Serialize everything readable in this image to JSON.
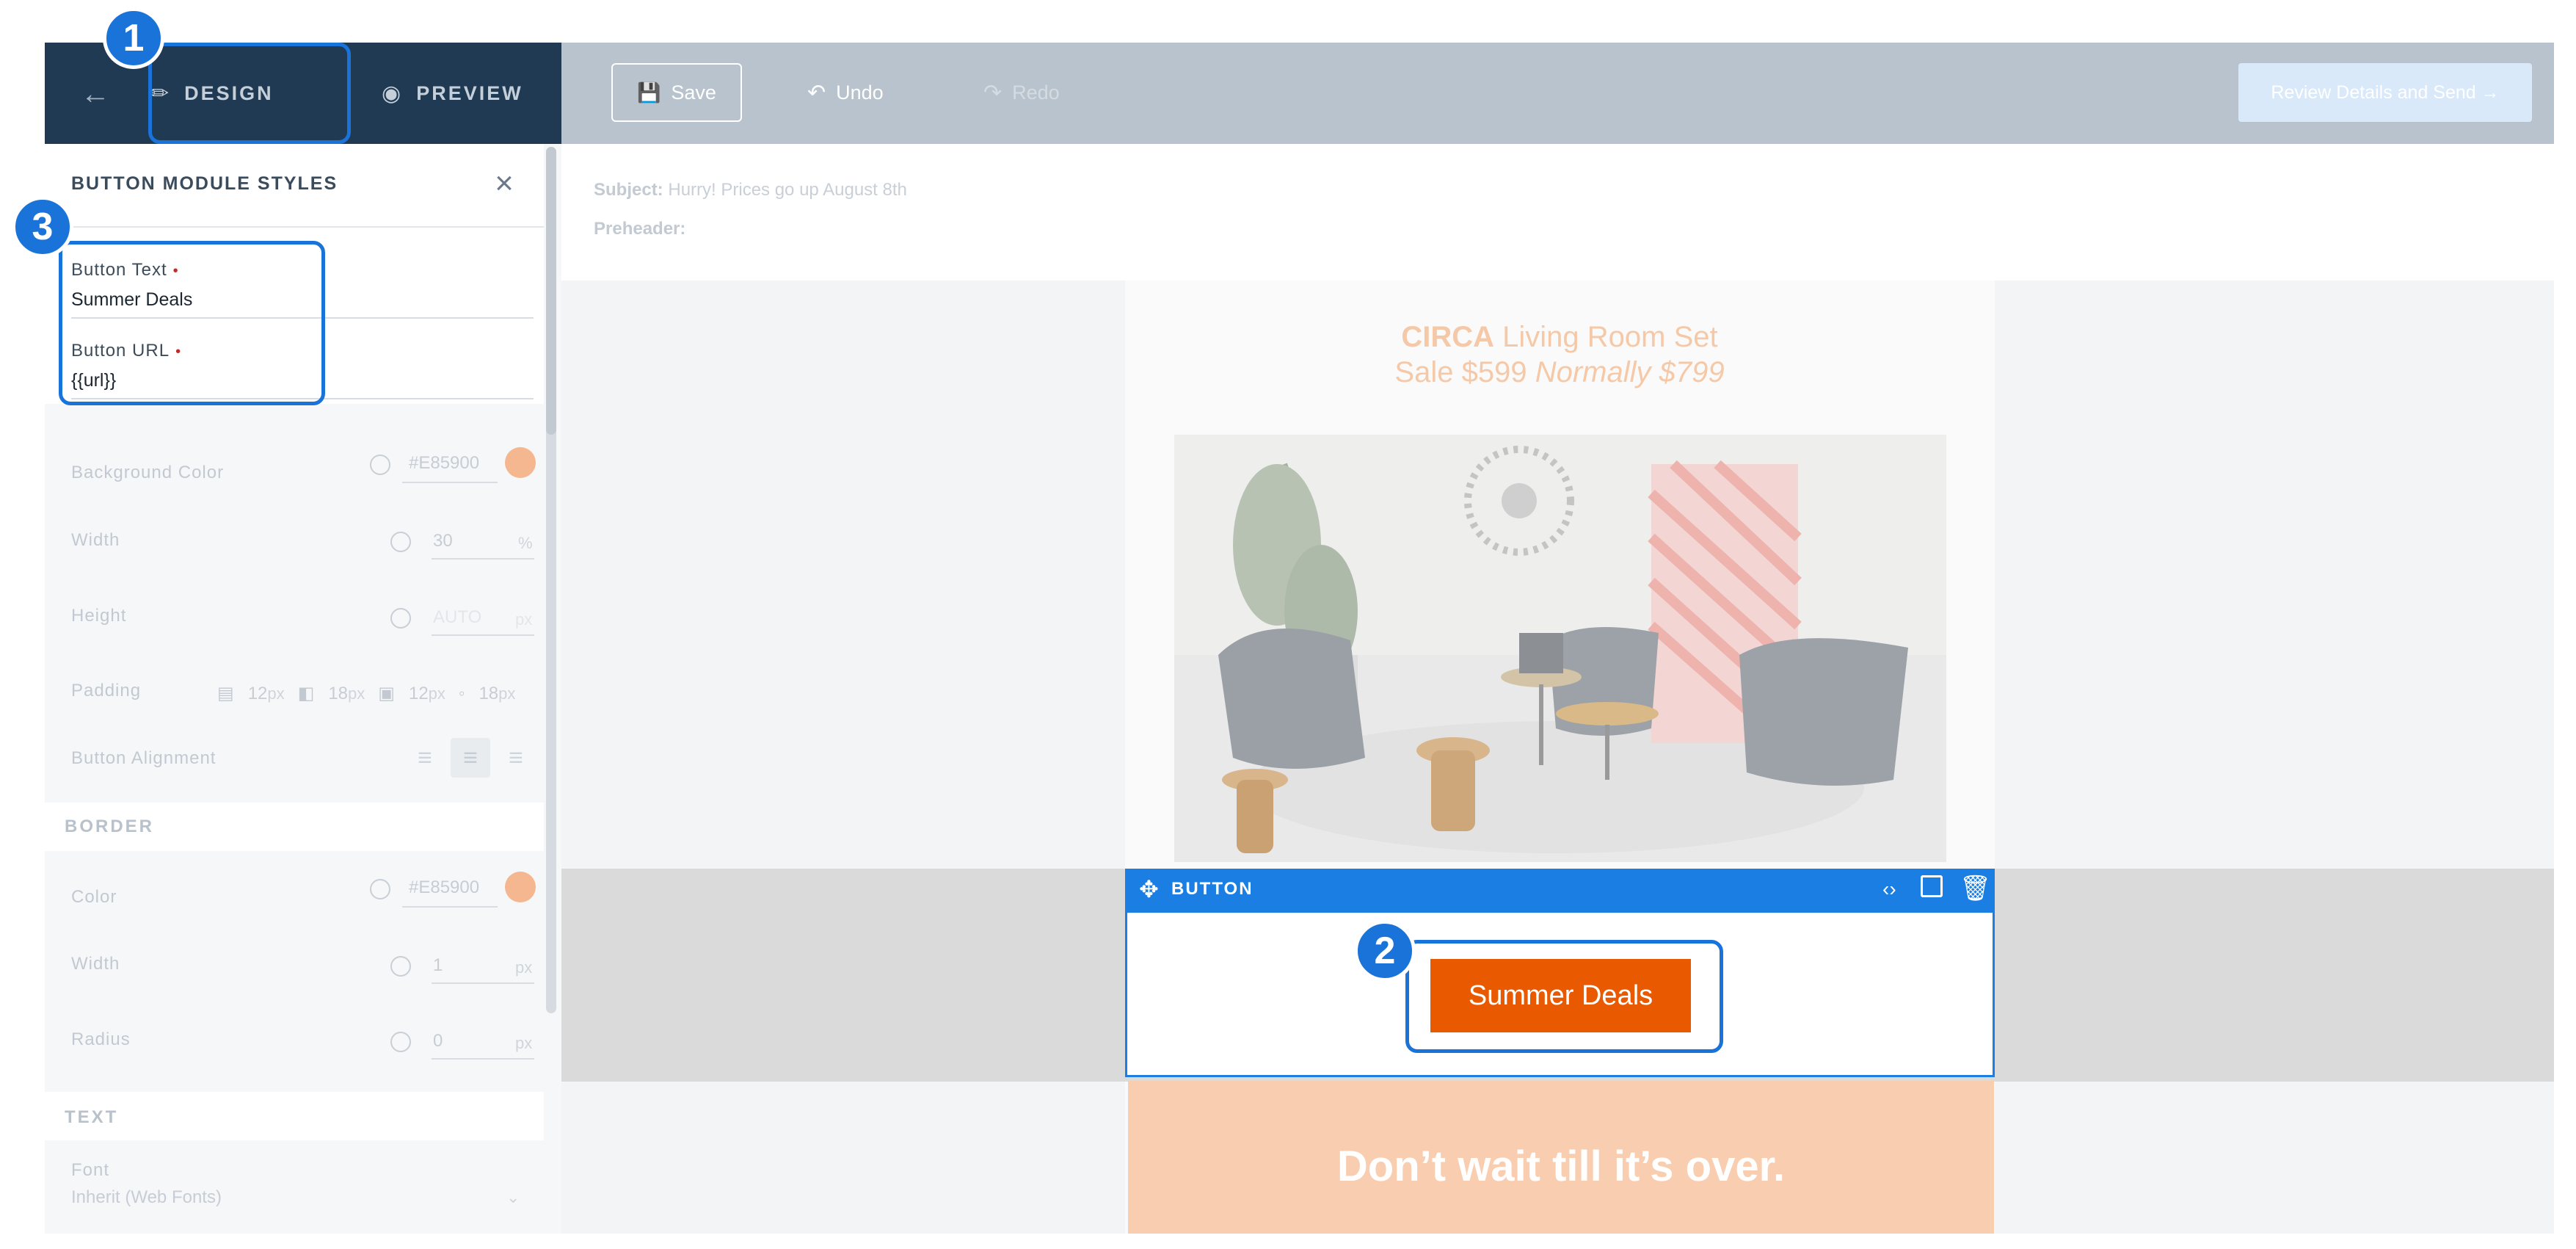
{
  "topbar": {
    "design_label": "DESIGN",
    "preview_label": "PREVIEW",
    "save_label": "Save",
    "undo_label": "Undo",
    "redo_label": "Redo",
    "review_label": "Review Details and Send →"
  },
  "sidebar": {
    "title": "BUTTON MODULE STYLES",
    "button_text_label": "Button Text",
    "button_text_value": "Summer Deals",
    "button_url_label": "Button URL",
    "button_url_value": "{{url}}",
    "required_mark": "•",
    "background_color_label": "Background Color",
    "background_color_value": "#E85900",
    "width_label": "Width",
    "width_value": "30",
    "width_unit": "%",
    "height_label": "Height",
    "height_value": "AUTO",
    "height_unit": "px",
    "padding_label": "Padding",
    "padding": [
      "12",
      "18",
      "12",
      "18"
    ],
    "padding_unit": "px",
    "alignment_label": "Button Alignment",
    "border_section": "BORDER",
    "border_color_label": "Color",
    "border_color_value": "#E85900",
    "border_width_label": "Width",
    "border_width_value": "1",
    "border_width_unit": "px",
    "radius_label": "Radius",
    "radius_value": "0",
    "radius_unit": "px",
    "text_section": "TEXT",
    "font_label": "Font",
    "font_value": "Inherit (Web Fonts)"
  },
  "email": {
    "subject_label": "Subject:",
    "subject_value": "Hurry! Prices go up August 8th",
    "preheader_label": "Preheader:",
    "hero_brand": "CIRCA",
    "hero_line1_rest": " Living Room Set",
    "hero_price": "Sale $599 ",
    "hero_normal_price": "Normally $799",
    "module_label": "BUTTON",
    "cta_label": "Summer Deals",
    "band_text": "Don’t wait till it’s over."
  },
  "callouts": [
    "1",
    "2",
    "3"
  ],
  "colors": {
    "accent": "#1a73d9",
    "cta": "#e85900",
    "swatch": "#f5b78f",
    "nav": "#1f3a52"
  }
}
